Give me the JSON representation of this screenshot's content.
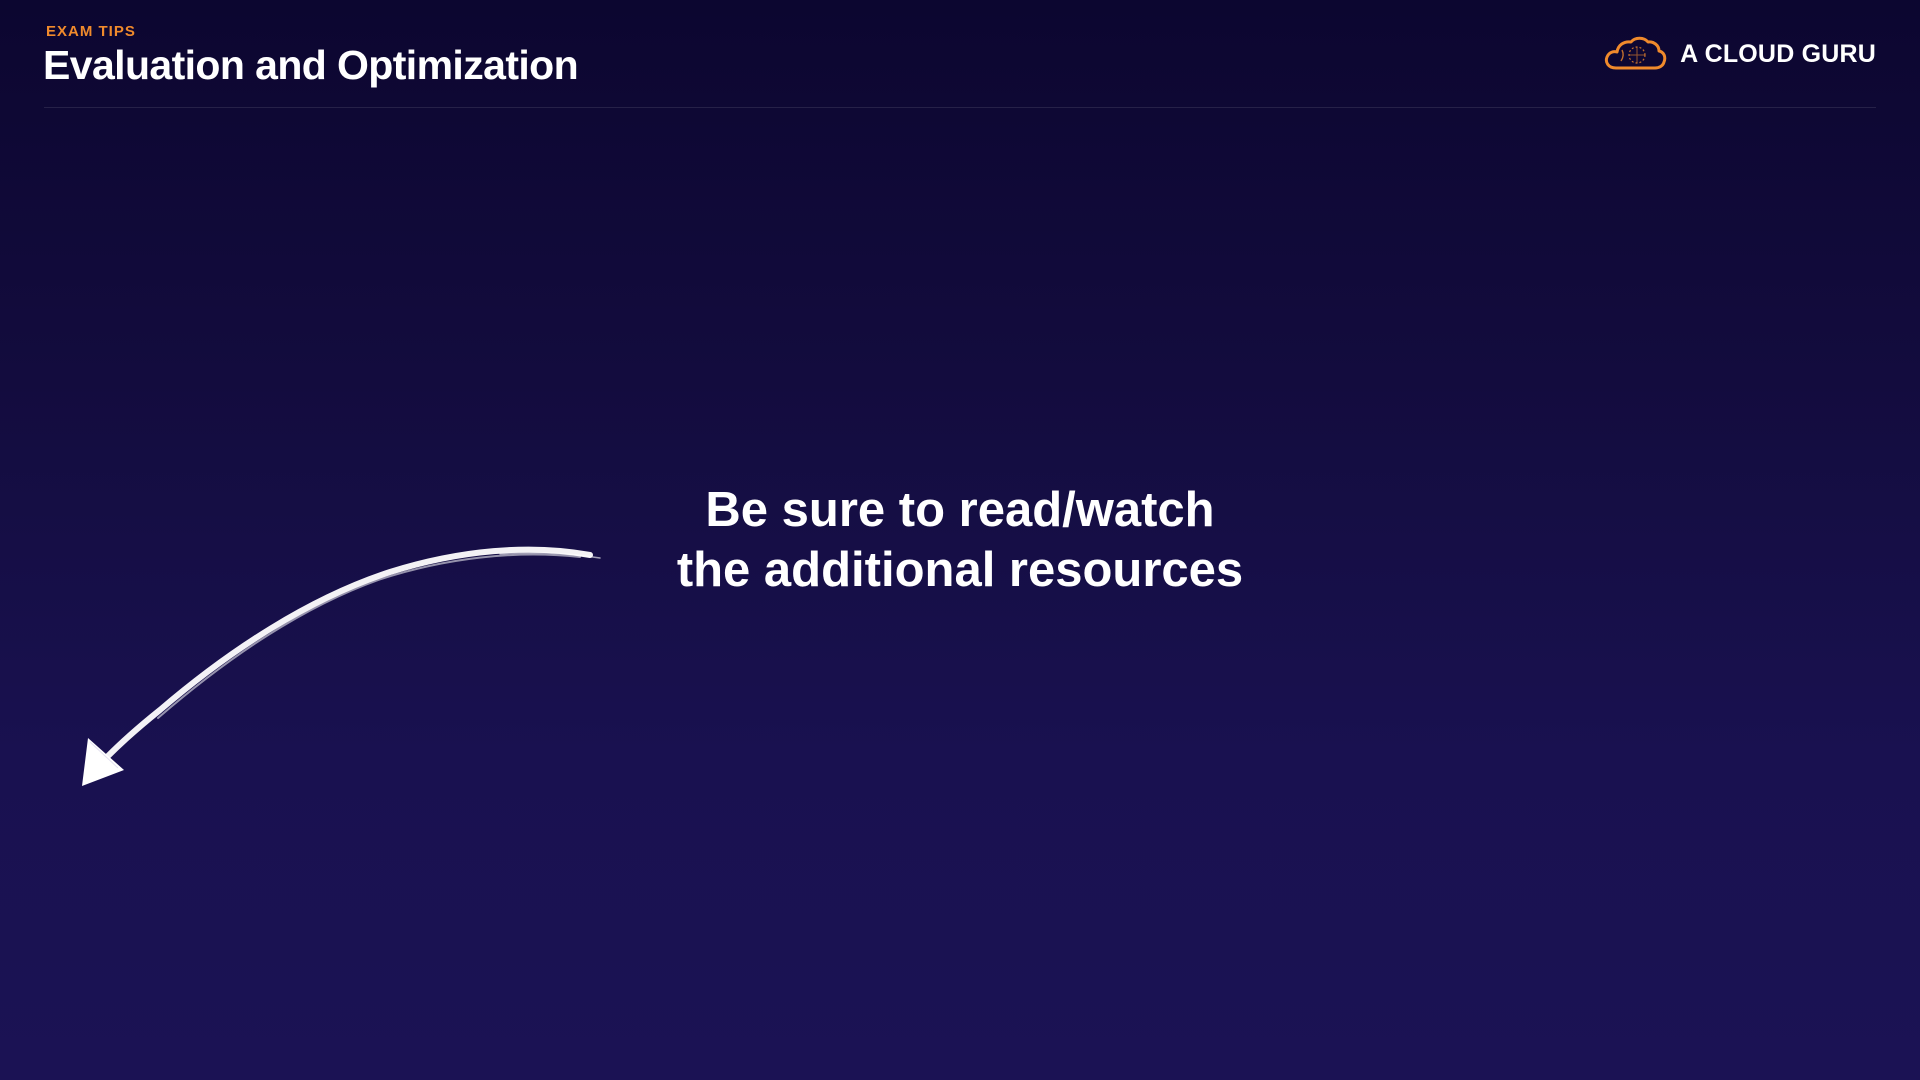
{
  "header": {
    "eyebrow": "EXAM TIPS",
    "title": "Evaluation and Optimization"
  },
  "brand": {
    "name": "A CLOUD GURU",
    "icon": "cloud-logo-icon",
    "accent_color": "#f08a2c"
  },
  "content": {
    "line1": "Be sure to read/watch",
    "line2": "the additional resources"
  },
  "decorations": {
    "arrow_icon": "curved-arrow-icon"
  },
  "colors": {
    "background_top": "#0c0630",
    "background_bottom": "#1b1254",
    "text": "#ffffff"
  }
}
